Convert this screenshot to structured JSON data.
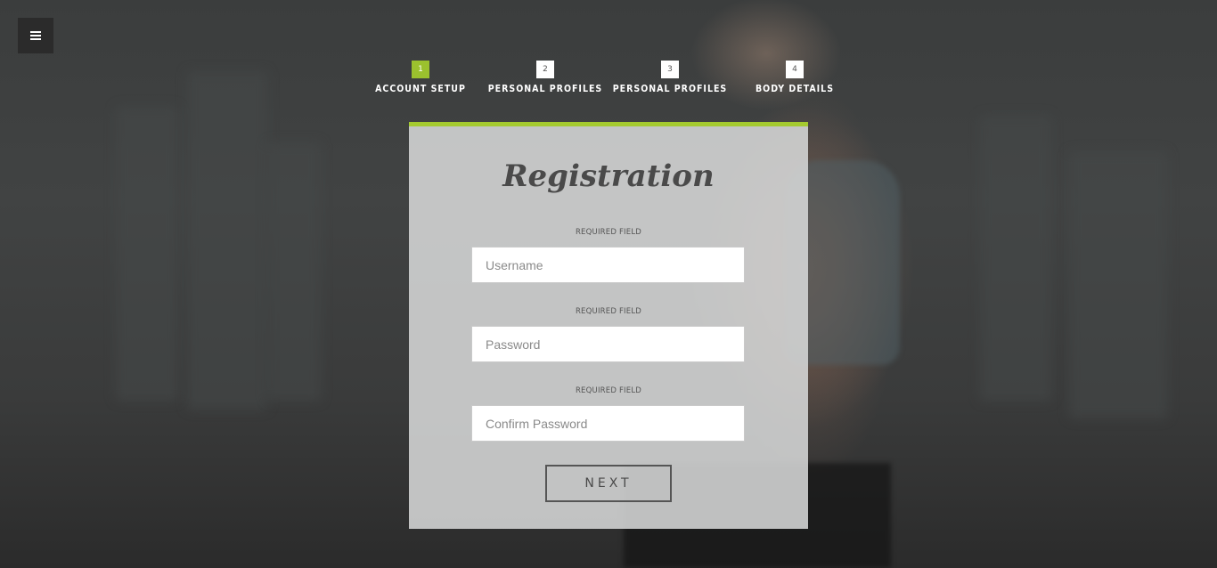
{
  "menu": {
    "icon": "hamburger-menu-icon"
  },
  "steps": [
    {
      "number": "1",
      "label": "ACCOUNT SETUP",
      "active": true
    },
    {
      "number": "2",
      "label": "PERSONAL PROFILES",
      "active": false
    },
    {
      "number": "3",
      "label": "PERSONAL PROFILES",
      "active": false
    },
    {
      "number": "4",
      "label": "BODY DETAILS",
      "active": false
    }
  ],
  "form": {
    "title": "Registration",
    "fields": [
      {
        "required_label": "REQUIRED FIELD",
        "placeholder": "Username",
        "value": ""
      },
      {
        "required_label": "REQUIRED FIELD",
        "placeholder": "Password",
        "value": ""
      },
      {
        "required_label": "REQUIRED FIELD",
        "placeholder": "Confirm Password",
        "value": ""
      }
    ],
    "next_label": "NEXT"
  },
  "colors": {
    "accent": "#9bc12e",
    "card_top_border": "#a4ca2f"
  }
}
